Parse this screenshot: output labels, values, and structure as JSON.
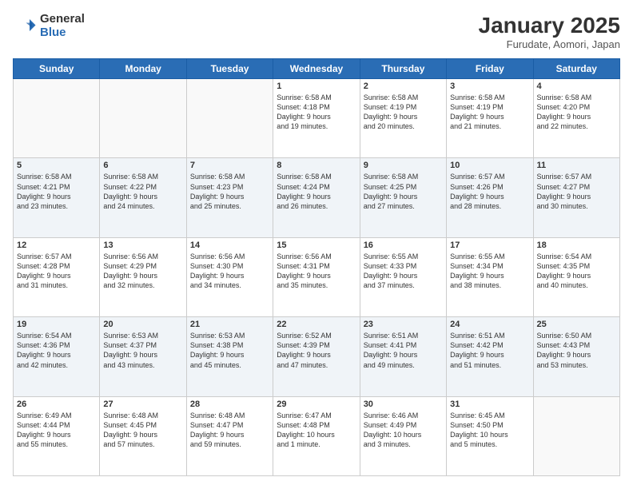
{
  "header": {
    "logo_general": "General",
    "logo_blue": "Blue",
    "title": "January 2025",
    "location": "Furudate, Aomori, Japan"
  },
  "days_of_week": [
    "Sunday",
    "Monday",
    "Tuesday",
    "Wednesday",
    "Thursday",
    "Friday",
    "Saturday"
  ],
  "weeks": [
    [
      {
        "num": "",
        "info": ""
      },
      {
        "num": "",
        "info": ""
      },
      {
        "num": "",
        "info": ""
      },
      {
        "num": "1",
        "info": "Sunrise: 6:58 AM\nSunset: 4:18 PM\nDaylight: 9 hours\nand 19 minutes."
      },
      {
        "num": "2",
        "info": "Sunrise: 6:58 AM\nSunset: 4:19 PM\nDaylight: 9 hours\nand 20 minutes."
      },
      {
        "num": "3",
        "info": "Sunrise: 6:58 AM\nSunset: 4:19 PM\nDaylight: 9 hours\nand 21 minutes."
      },
      {
        "num": "4",
        "info": "Sunrise: 6:58 AM\nSunset: 4:20 PM\nDaylight: 9 hours\nand 22 minutes."
      }
    ],
    [
      {
        "num": "5",
        "info": "Sunrise: 6:58 AM\nSunset: 4:21 PM\nDaylight: 9 hours\nand 23 minutes."
      },
      {
        "num": "6",
        "info": "Sunrise: 6:58 AM\nSunset: 4:22 PM\nDaylight: 9 hours\nand 24 minutes."
      },
      {
        "num": "7",
        "info": "Sunrise: 6:58 AM\nSunset: 4:23 PM\nDaylight: 9 hours\nand 25 minutes."
      },
      {
        "num": "8",
        "info": "Sunrise: 6:58 AM\nSunset: 4:24 PM\nDaylight: 9 hours\nand 26 minutes."
      },
      {
        "num": "9",
        "info": "Sunrise: 6:58 AM\nSunset: 4:25 PM\nDaylight: 9 hours\nand 27 minutes."
      },
      {
        "num": "10",
        "info": "Sunrise: 6:57 AM\nSunset: 4:26 PM\nDaylight: 9 hours\nand 28 minutes."
      },
      {
        "num": "11",
        "info": "Sunrise: 6:57 AM\nSunset: 4:27 PM\nDaylight: 9 hours\nand 30 minutes."
      }
    ],
    [
      {
        "num": "12",
        "info": "Sunrise: 6:57 AM\nSunset: 4:28 PM\nDaylight: 9 hours\nand 31 minutes."
      },
      {
        "num": "13",
        "info": "Sunrise: 6:56 AM\nSunset: 4:29 PM\nDaylight: 9 hours\nand 32 minutes."
      },
      {
        "num": "14",
        "info": "Sunrise: 6:56 AM\nSunset: 4:30 PM\nDaylight: 9 hours\nand 34 minutes."
      },
      {
        "num": "15",
        "info": "Sunrise: 6:56 AM\nSunset: 4:31 PM\nDaylight: 9 hours\nand 35 minutes."
      },
      {
        "num": "16",
        "info": "Sunrise: 6:55 AM\nSunset: 4:33 PM\nDaylight: 9 hours\nand 37 minutes."
      },
      {
        "num": "17",
        "info": "Sunrise: 6:55 AM\nSunset: 4:34 PM\nDaylight: 9 hours\nand 38 minutes."
      },
      {
        "num": "18",
        "info": "Sunrise: 6:54 AM\nSunset: 4:35 PM\nDaylight: 9 hours\nand 40 minutes."
      }
    ],
    [
      {
        "num": "19",
        "info": "Sunrise: 6:54 AM\nSunset: 4:36 PM\nDaylight: 9 hours\nand 42 minutes."
      },
      {
        "num": "20",
        "info": "Sunrise: 6:53 AM\nSunset: 4:37 PM\nDaylight: 9 hours\nand 43 minutes."
      },
      {
        "num": "21",
        "info": "Sunrise: 6:53 AM\nSunset: 4:38 PM\nDaylight: 9 hours\nand 45 minutes."
      },
      {
        "num": "22",
        "info": "Sunrise: 6:52 AM\nSunset: 4:39 PM\nDaylight: 9 hours\nand 47 minutes."
      },
      {
        "num": "23",
        "info": "Sunrise: 6:51 AM\nSunset: 4:41 PM\nDaylight: 9 hours\nand 49 minutes."
      },
      {
        "num": "24",
        "info": "Sunrise: 6:51 AM\nSunset: 4:42 PM\nDaylight: 9 hours\nand 51 minutes."
      },
      {
        "num": "25",
        "info": "Sunrise: 6:50 AM\nSunset: 4:43 PM\nDaylight: 9 hours\nand 53 minutes."
      }
    ],
    [
      {
        "num": "26",
        "info": "Sunrise: 6:49 AM\nSunset: 4:44 PM\nDaylight: 9 hours\nand 55 minutes."
      },
      {
        "num": "27",
        "info": "Sunrise: 6:48 AM\nSunset: 4:45 PM\nDaylight: 9 hours\nand 57 minutes."
      },
      {
        "num": "28",
        "info": "Sunrise: 6:48 AM\nSunset: 4:47 PM\nDaylight: 9 hours\nand 59 minutes."
      },
      {
        "num": "29",
        "info": "Sunrise: 6:47 AM\nSunset: 4:48 PM\nDaylight: 10 hours\nand 1 minute."
      },
      {
        "num": "30",
        "info": "Sunrise: 6:46 AM\nSunset: 4:49 PM\nDaylight: 10 hours\nand 3 minutes."
      },
      {
        "num": "31",
        "info": "Sunrise: 6:45 AM\nSunset: 4:50 PM\nDaylight: 10 hours\nand 5 minutes."
      },
      {
        "num": "",
        "info": ""
      }
    ]
  ]
}
